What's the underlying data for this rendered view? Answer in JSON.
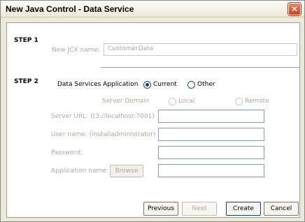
{
  "window": {
    "title": "New Java Control - Data Service",
    "close_glyph": "✕"
  },
  "step1": {
    "label": "STEP 1",
    "jcx_label": "New JCX name:",
    "jcx_value": "CustomerData"
  },
  "step2": {
    "label": "STEP 2",
    "app_label": "Data Services Application",
    "app_options": [
      {
        "label": "Current",
        "selected": true
      },
      {
        "label": "Other",
        "selected": false
      }
    ],
    "domain_label": "Server Domain",
    "domain_options": [
      {
        "label": "Local",
        "selected": false
      },
      {
        "label": "Remote",
        "selected": false
      }
    ],
    "server_url_label": "Server URL: (t3://localhost:7001)",
    "server_url_value": "",
    "username_label": "User name: (installadministrator)",
    "username_value": "",
    "password_label": "Password:",
    "password_value": "",
    "appname_label": "Application name:",
    "browse_label": "Browse",
    "appname_value": ""
  },
  "footer": {
    "previous": "Previous",
    "next": "Next",
    "create": "Create",
    "cancel": "Cancel"
  },
  "colors": {
    "disabled_text": "#acaa9d",
    "field_border": "#7f9db9",
    "close_red": "#c8421f"
  }
}
